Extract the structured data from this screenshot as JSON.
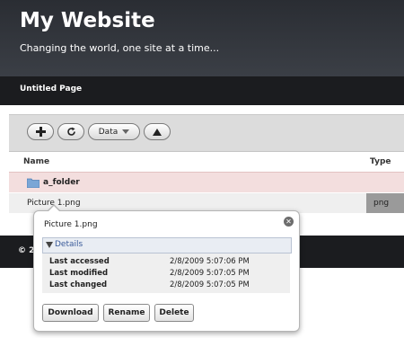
{
  "header": {
    "title": "My Website",
    "tagline": "Changing the world, one site at a time..."
  },
  "nav": {
    "page_name": "Untitled Page"
  },
  "toolbar": {
    "add_icon": "plus-icon",
    "refresh_icon": "refresh-icon",
    "data_label": "Data",
    "data_dropdown_icon": "chevron-down-icon",
    "up_icon": "up-arrow-icon"
  },
  "file_list": {
    "columns": [
      "Name",
      "Type"
    ],
    "rows": [
      {
        "name": "a_folder",
        "type": "",
        "icon": "folder-icon"
      },
      {
        "name": "Picture 1.png",
        "type": "png"
      }
    ]
  },
  "footer": {
    "text": "© 2"
  },
  "popup": {
    "title": "Picture 1.png",
    "details_label": "Details",
    "details": [
      {
        "label": "Last accessed",
        "value": "2/8/2009 5:07:06 PM"
      },
      {
        "label": "Last modified",
        "value": "2/8/2009 5:07:05 PM"
      },
      {
        "label": "Last changed",
        "value": "2/8/2009 5:07:05 PM"
      }
    ],
    "buttons": {
      "download": "Download",
      "rename": "Rename",
      "delete": "Delete"
    }
  },
  "colors": {
    "header_bg": "#2a2d33",
    "nav_bg": "#1b1c1f",
    "folder_row_bg": "#f3dede",
    "details_link": "#3a5b9a"
  }
}
